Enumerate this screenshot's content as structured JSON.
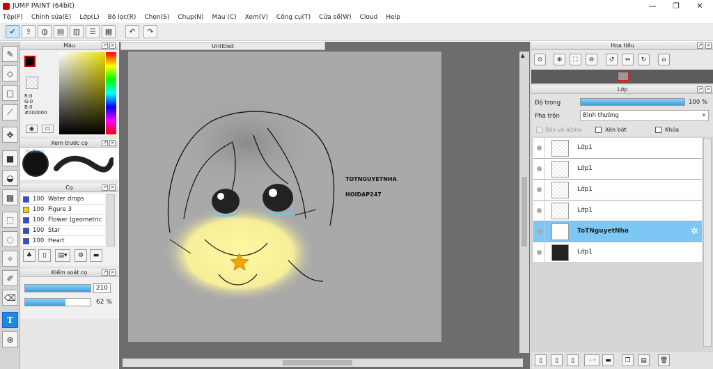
{
  "window": {
    "title": "JUMP PAINT (64bit)",
    "minimize": "—",
    "maximize": "❐",
    "close": "✕"
  },
  "menu": [
    "Tệp(F)",
    "Chỉnh sửa(E)",
    "Lớp(L)",
    "Bộ lọc(R)",
    "Chọn(S)",
    "Chụp(N)",
    "Màu (C)",
    "Xem(V)",
    "Công cụ(T)",
    "Cửa sổ(W)",
    "Cloud",
    "Help"
  ],
  "colorPanel": {
    "title": "Màu",
    "r": "R:0",
    "g": "G:0",
    "b": "B:0",
    "hex": "#000000"
  },
  "brushPreview": {
    "title": "Xem trước cọ",
    "size": "16.25mm"
  },
  "brushPanel": {
    "title": "Cọ",
    "items": [
      {
        "opacity": "100",
        "name": "Water drops",
        "color": "#3050d0"
      },
      {
        "opacity": "100",
        "name": "Figure 3",
        "color": "#e8d020"
      },
      {
        "opacity": "100",
        "name": "Flower (geometric p",
        "color": "#3050d0"
      },
      {
        "opacity": "100",
        "name": "Star",
        "color": "#3050d0"
      },
      {
        "opacity": "100",
        "name": "Heart",
        "color": "#3050d0"
      }
    ]
  },
  "brushControl": {
    "title": "Kiểm soát cọ",
    "size": "210",
    "opacity": "62 %",
    "sizeFill": 1.0,
    "opacityFill": 0.62
  },
  "canvas": {
    "tab": "Untitled",
    "text1": "TOTNGUYETNHA",
    "text2": "HOIDAP247"
  },
  "navigator": {
    "title": "Hoa tiêu"
  },
  "layers": {
    "title": "Lớp",
    "opacityLabel": "Độ trong",
    "opacityValue": "100 %",
    "blendLabel": "Pha trộn",
    "blendValue": "Bình thường",
    "protectAlpha": "Bảo vệ alpha",
    "clipping": "Xén bớt",
    "lock": "Khóa",
    "rows": [
      {
        "name": "Lớp1"
      },
      {
        "name": "Lớp1"
      },
      {
        "name": "Lớp1"
      },
      {
        "name": "Lớp1"
      },
      {
        "name": "ToTNguyetNha"
      },
      {
        "name": "Lớp1"
      }
    ]
  },
  "accent": "#1e88e5"
}
